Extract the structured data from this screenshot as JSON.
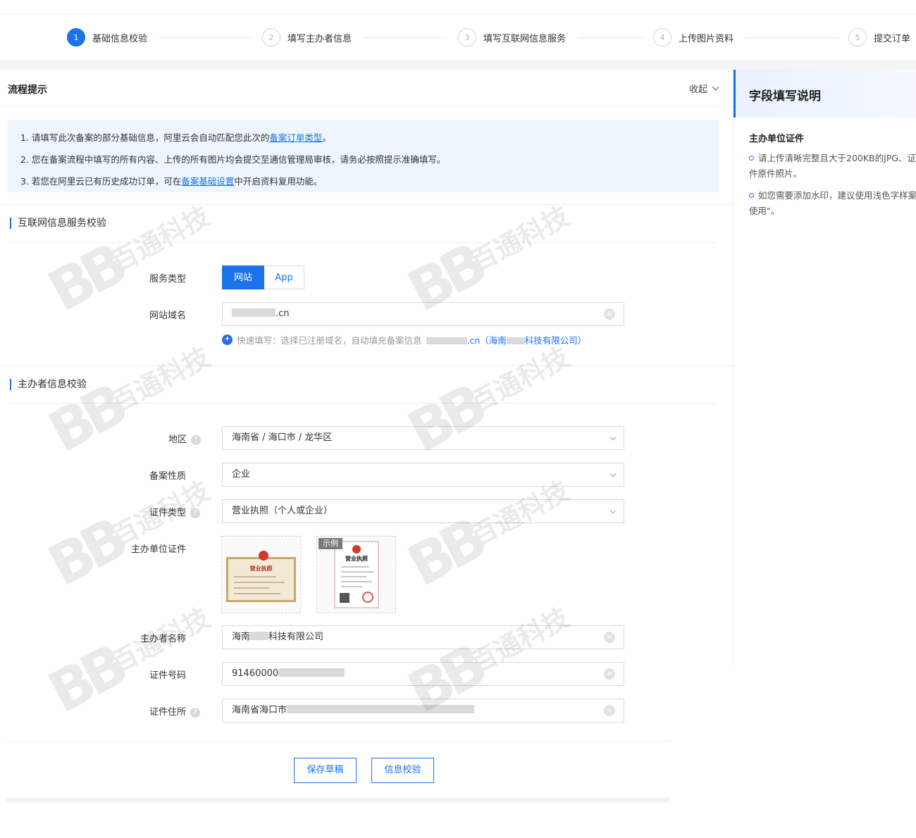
{
  "steps": [
    {
      "num": "1",
      "label": "基础信息校验",
      "active": true
    },
    {
      "num": "2",
      "label": "填写主办者信息",
      "active": false
    },
    {
      "num": "3",
      "label": "填写互联网信息服务",
      "active": false
    },
    {
      "num": "4",
      "label": "上传图片资料",
      "active": false
    },
    {
      "num": "5",
      "label": "提交订单",
      "active": false
    }
  ],
  "tips": {
    "title": "流程提示",
    "collapse_label": "收起",
    "line1_pre": "1. 请填写此次备案的部分基础信息，阿里云会自动匹配您此次的",
    "line1_link": "备案订单类型",
    "line1_post": "。",
    "line2": "2. 您在备案流程中填写的所有内容、上传的所有图片均会提交至通信管理局审核，请务必按照提示准确填写。",
    "line3_pre": "3. 若您在阿里云已有历史成功订单，可在",
    "line3_link": "备案基础设置",
    "line3_post": "中开启资料复用功能。"
  },
  "section_internet": {
    "title": "互联网信息服务校验",
    "service_type_label": "服务类型",
    "service_options": [
      "网站",
      "App"
    ],
    "domain_label": "网站域名",
    "domain_value_suffix": ".cn",
    "quick_fill_text": "快速填写：选择已注册域名，自动填充备案信息",
    "quick_fill_domain_suffix": ".cn（海南",
    "quick_fill_company_suffix": "科技有限公司）"
  },
  "section_sponsor": {
    "title": "主办者信息校验",
    "region_label": "地区",
    "region_value": "海南省 / 海口市 / 龙华区",
    "nature_label": "备案性质",
    "nature_value": "企业",
    "cert_type_label": "证件类型",
    "cert_type_value": "营业执照（个人或企业）",
    "cert_doc_label": "主办单位证件",
    "cert_title": "营业执照",
    "sample_tag": "示例",
    "name_label": "主办者名称",
    "name_prefix": "海南",
    "name_suffix": "科技有限公司",
    "cert_no_label": "证件号码",
    "cert_no_value": "91460000",
    "address_label": "证件住所",
    "address_value": "海南省海口市"
  },
  "buttons": {
    "save_draft": "保存草稿",
    "verify": "信息校验"
  },
  "right_panel": {
    "title": "字段填写说明",
    "subtitle": "主办单位证件",
    "item1": "请上传清晰完整且大于200KB的JPG、证件原件照片。",
    "item2": "如您需要添加水印，建议使用浅色字样案使用\"。"
  },
  "watermark": {
    "logo": "BB",
    "text": "百通科技"
  },
  "colors": {
    "accent": "#1a73e8",
    "tip_bg": "#eef5fd",
    "border": "#d9d9d9"
  }
}
